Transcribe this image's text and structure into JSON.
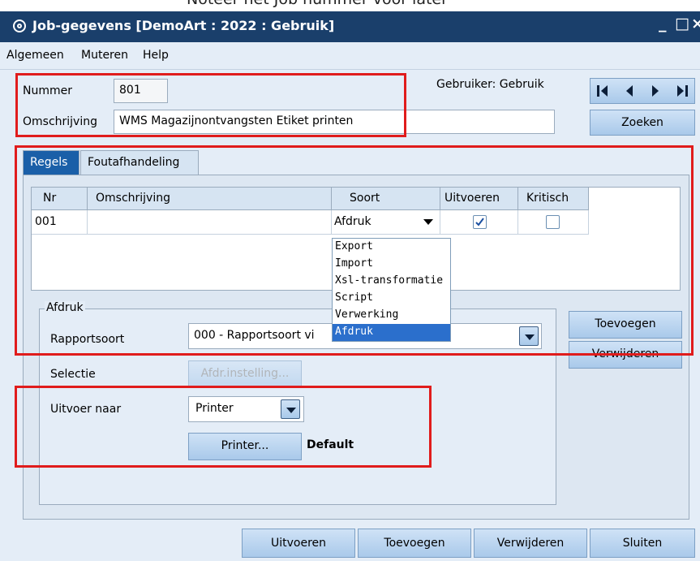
{
  "top_strip_text": "Noteer het Job nummer voor later",
  "window": {
    "title": "Job-gegevens  [DemoArt : 2022 : Gebruik]",
    "minimize": "_",
    "maximize": "□",
    "close": "×"
  },
  "menu": {
    "items": [
      "Algemeen",
      "Muteren",
      "Help"
    ]
  },
  "header": {
    "nummer_label": "Nummer",
    "nummer_value": "801",
    "omschrijving_label": "Omschrijving",
    "omschrijving_value": "WMS Magazijnontvangsten Etiket printen",
    "gebruiker": "Gebruiker: Gebruik",
    "zoeken_label": "Zoeken"
  },
  "nav_icons": [
    "first-record-icon",
    "previous-record-icon",
    "next-record-icon",
    "last-record-icon"
  ],
  "tabs": [
    {
      "label": "Regels",
      "active": true
    },
    {
      "label": "Foutafhandeling",
      "active": false
    }
  ],
  "grid": {
    "columns": [
      "Nr",
      "Omschrijving",
      "Soort",
      "Uitvoeren",
      "Kritisch"
    ],
    "rows": [
      {
        "nr": "001",
        "omschrijving": "",
        "soort": "Afdruk",
        "uitvoeren": true,
        "kritisch": false
      }
    ]
  },
  "soort_dropdown": {
    "options": [
      "Export",
      "Import",
      "Xsl-transformatie",
      "Script",
      "Verwerking",
      "Afdruk"
    ],
    "selected": "Afdruk"
  },
  "afdruk": {
    "group_label": "Afdruk",
    "rapportsoort_label": "Rapportsoort",
    "rapportsoort_value": "000 - Rapportsoort vi",
    "selectie_label": "Selectie",
    "afdr_button": "Afdr.instelling...",
    "uitvoer_label": "Uitvoer naar",
    "uitvoer_value": "Printer",
    "printer_button": "Printer...",
    "printer_default": "Default"
  },
  "side_buttons": {
    "toevoegen": "Toevoegen",
    "verwijderen": "Verwijderen"
  },
  "footer_buttons": {
    "uitvoeren": "Uitvoeren",
    "toevoegen": "Toevoegen",
    "verwijderen": "Verwijderen",
    "sluiten": "Sluiten"
  },
  "colors": {
    "titlebar": "#1a3f6b",
    "window": "#e4edf7",
    "highlight": "#2b6fcc",
    "annotation": "#e01c1c"
  }
}
